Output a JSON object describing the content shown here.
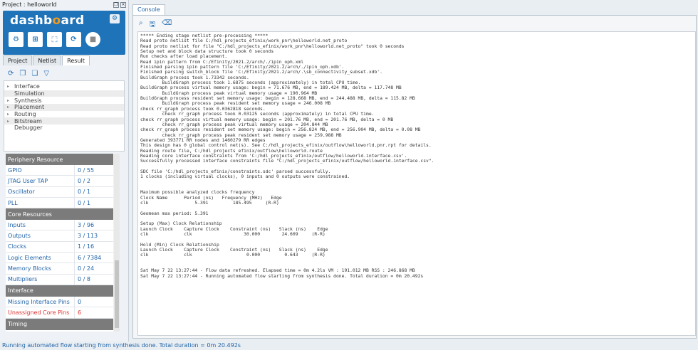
{
  "project": {
    "title": "Project : helloworld"
  },
  "dashboard": {
    "logo_prefix": "dashb",
    "logo_o": "o",
    "logo_suffix": "ard",
    "icons": [
      "design-icon",
      "interface-icon",
      "floorplan-icon",
      "debugger-icon",
      "stop-icon"
    ]
  },
  "tabs": [
    "Project",
    "Netlist",
    "Result"
  ],
  "active_tab": "Result",
  "flow_steps": [
    {
      "label": "Interface",
      "expandable": true,
      "shaded": false
    },
    {
      "label": "Simulation",
      "expandable": false,
      "shaded": true
    },
    {
      "label": "Synthesis",
      "expandable": true,
      "shaded": false
    },
    {
      "label": "Placement",
      "expandable": true,
      "shaded": true
    },
    {
      "label": "Routing",
      "expandable": true,
      "shaded": false
    },
    {
      "label": "Bitstream",
      "expandable": true,
      "shaded": true
    },
    {
      "label": "Debugger",
      "expandable": false,
      "shaded": false
    }
  ],
  "resources": [
    {
      "type": "header",
      "label": "Periphery Resource"
    },
    {
      "type": "row",
      "label": "GPIO",
      "value": "0 / 55"
    },
    {
      "type": "row",
      "label": "JTAG User TAP",
      "value": "0 / 2"
    },
    {
      "type": "row",
      "label": "Oscillator",
      "value": "0 / 1"
    },
    {
      "type": "row",
      "label": "PLL",
      "value": "0 / 1"
    },
    {
      "type": "header",
      "label": "Core Resources"
    },
    {
      "type": "row",
      "label": "Inputs",
      "value": "3 / 96"
    },
    {
      "type": "row",
      "label": "Outputs",
      "value": "3 / 113"
    },
    {
      "type": "row",
      "label": "Clocks",
      "value": "1 / 16"
    },
    {
      "type": "row",
      "label": "Logic Elements",
      "value": "6 / 7384"
    },
    {
      "type": "row",
      "label": "Memory Blocks",
      "value": "0 / 24"
    },
    {
      "type": "row",
      "label": "Multipliers",
      "value": "0 / 8"
    },
    {
      "type": "header",
      "label": "Interface"
    },
    {
      "type": "row",
      "label": "Missing Interface Pins",
      "value": "0"
    },
    {
      "type": "row",
      "label": "Unassigned Core Pins",
      "value": "6",
      "red": true
    },
    {
      "type": "header",
      "label": "Timing"
    }
  ],
  "console": {
    "tab": "Console",
    "lines": [
      "***** Ending stage netlist pre-processing *****",
      "Read proto netlist file C:/hdl_projects_efinix/work_pnr\\helloworld.net_proto",
      "Read proto netlist for file \"C:/hdl_projects_efinix/work_pnr\\helloworld.net_proto\" took 0 seconds",
      "Setup net and block data structure took 0 seconds",
      "Run checks after load placement.",
      "Read ipin pattern from C:/Efinity/2021.2/arch/./ipin_oph.xml",
      "Finished parsing ipin pattern file 'C:/Efinity/2021.2/arch/./ipin_oph.xdb'.",
      "Finished parsing switch_block file 'C:/Efinity/2021.2/arch/.\\sb_connectivity_subset.xdb'.",
      "BuildGraph process took 1.73342 seconds.",
      "        BuildGraph process took 1.6875 seconds (approximately) in total CPU time.",
      "BuildGraph process virtual memory usage: begin = 71.676 MB, end = 189.424 MB, delta = 117.748 MB",
      "        BuildGraph process peak virtual memory usage = 190.964 MB",
      "BuildGraph process resident set memory usage: begin = 128.668 MB, end = 244.488 MB, delta = 115.82 MB",
      "        BuildGraph process peak resident set memory usage = 246.008 MB",
      "check rr_graph process took 0.0362818 seconds.",
      "        check rr_graph process took 0.03125 seconds (approximately) in total CPU time.",
      "check rr_graph process virtual memory usage: begin = 201.76 MB, end = 201.76 MB, delta = 0 MB",
      "        check rr_graph process peak virtual memory usage = 204.844 MB",
      "check rr_graph process resident set memory usage: begin = 256.824 MB, end = 256.904 MB, delta = 0.08 MB",
      "        check rr_graph process peak resident set memory usage = 259.988 MB",
      "Generated 393771 RR nodes and 1460279 RR edges",
      "This design has 0 global control net(s). See C:/hdl_projects_efinix/outflow\\helloworld.pnr.rpt for details.",
      "Reading route file, C:/hdl_projects_efinix/outflow\\helloworld.route",
      "Reading core interface constraints from 'C:/hdl_projects_efinix/outflow/helloworld.interface.csv'.",
      "Successfully processed interface constraints file \"C:/hdl_projects_efinix/outflow/helloworld.interface.csv\".",
      "",
      "SDC file 'C:/hdl_projects_efinix/constraints.sdc' parsed successfully.",
      "1 clocks (including virtual clocks), 0 inputs and 0 outputs were constrained.",
      "",
      "",
      "Maximum possible analyzed clocks frequency",
      "Clock Name      Period (ns)   Frequency (MHz)   Edge",
      "clk                 5.391         185.495     (R-R)",
      "",
      "Geomean max period: 5.391",
      "",
      "Setup (Max) Clock Relationship",
      "Launch Clock    Capture Clock    Constraint (ns)   Slack (ns)    Edge",
      "clk             clk                   30.000        24.609     (R-R)",
      "",
      "Hold (Min) Clock Relationship",
      "Launch Clock    Capture Clock    Constraint (ns)   Slack (ns)    Edge",
      "clk             clk                    0.000         0.643     (R-R)",
      "",
      "",
      "Sat May 7 22 13:27:44 - Flow data refreshed. Elapsed time = 0m 4.2ls VM : 191.012 MB RSS : 246.868 MB",
      "Sat May 7 22 13:27:44 - Running automated flow starting from synthesis done. Total duration = 0m 20.492s"
    ]
  },
  "status_bar": "Running automated flow starting from synthesis done. Total duration = 0m 20.492s"
}
